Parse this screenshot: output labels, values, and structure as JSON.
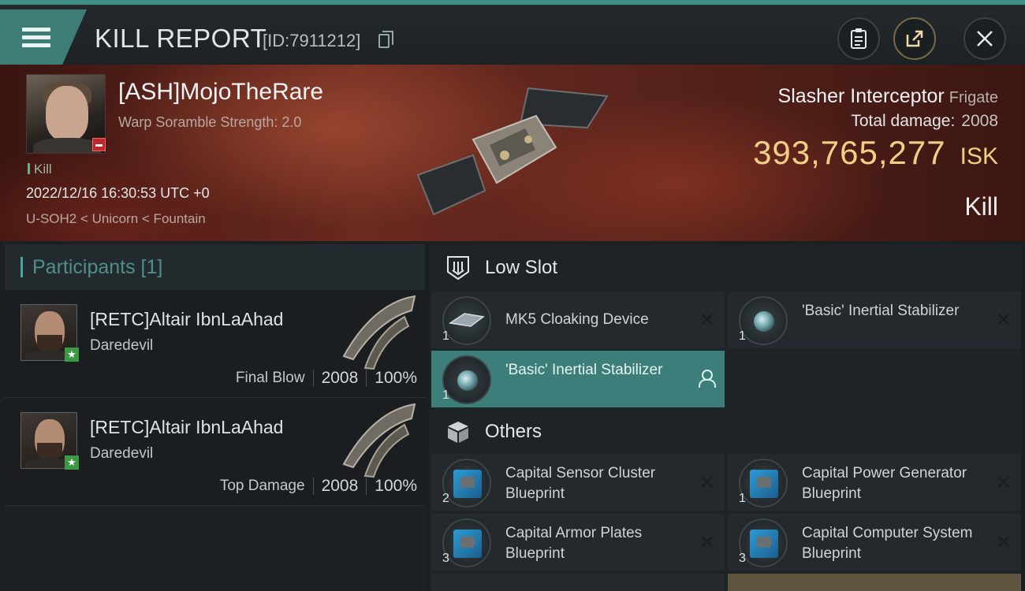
{
  "header": {
    "title": "KILL REPORT",
    "kill_id": "[ID:7911212]",
    "icons": {
      "menu": "menu-icon",
      "copy": "copy-icon",
      "report": "clipboard-icon",
      "share": "share-icon",
      "close": "close-icon"
    }
  },
  "victim": {
    "name": "[ASH]MojoTheRare",
    "scramble": "Warp Soramble Strength: 2.0",
    "tag": "Kill",
    "datetime": "2022/12/16 16:30:53 UTC +0",
    "location": "U-SOH2 < Unicorn < Fountain",
    "ship_name": "Slasher Interceptor",
    "ship_class": "Frigate",
    "total_damage_label": "Total damage:",
    "total_damage": "2008",
    "isk_value": "393,765,277",
    "isk_unit": "ISK",
    "result": "Kill"
  },
  "participants": {
    "header": "Participants [1]",
    "rows": [
      {
        "name": "[RETC]Altair IbnLaAhad",
        "ship": "Daredevil",
        "label": "Final Blow",
        "damage": "2008",
        "percent": "100%"
      },
      {
        "name": "[RETC]Altair IbnLaAhad",
        "ship": "Daredevil",
        "label": "Top Damage",
        "damage": "2008",
        "percent": "100%"
      }
    ]
  },
  "fitting": {
    "low_slot": {
      "title": "Low Slot",
      "items": [
        {
          "name": "MK5 Cloaking Device",
          "qty": "1"
        },
        {
          "name": "'Basic' Inertial Stabilizer",
          "qty": "1"
        },
        {
          "name": "'Basic' Inertial Stabilizer",
          "qty": "1"
        }
      ]
    },
    "others": {
      "title": "Others",
      "items": [
        {
          "name": "Capital Sensor Cluster Blueprint",
          "qty": "2"
        },
        {
          "name": "Capital Power Generator Blueprint",
          "qty": "1"
        },
        {
          "name": "Capital Armor Plates Blueprint",
          "qty": "3"
        },
        {
          "name": "Capital Computer System Blueprint",
          "qty": "3"
        }
      ]
    }
  },
  "colors": {
    "accent": "#3d7d76",
    "isk": "#f2cf86",
    "active_slot": "#3c7f7a"
  }
}
